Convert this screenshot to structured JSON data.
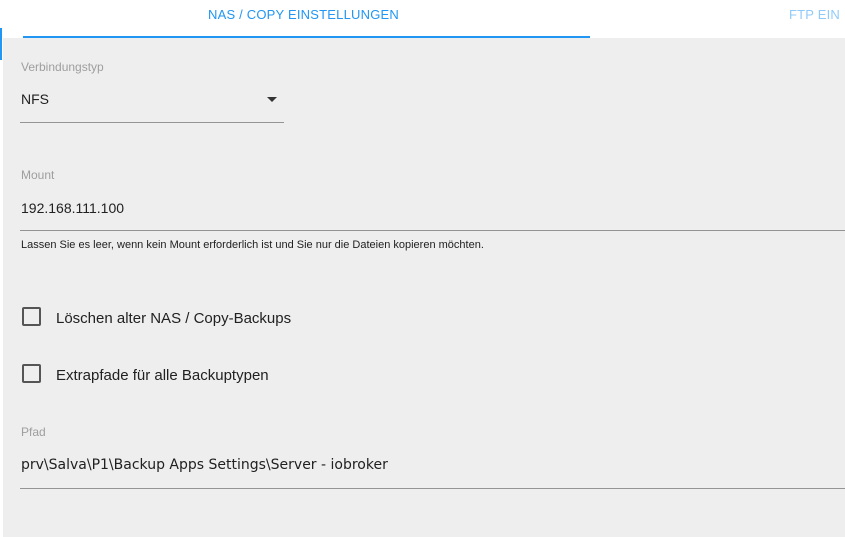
{
  "tabs": [
    {
      "label": "NAS / COPY EINSTELLUNGEN",
      "active": true
    },
    {
      "label": "FTP EIN",
      "active": false
    }
  ],
  "connection_type": {
    "label": "Verbindungstyp",
    "value": "NFS"
  },
  "mount": {
    "label": "Mount",
    "value": "192.168.111.100",
    "helper": "Lassen Sie es leer, wenn kein Mount erforderlich ist und Sie nur die Dateien kopieren möchten."
  },
  "checkboxes": [
    {
      "label": "Löschen alter NAS / Copy-Backups",
      "checked": false
    },
    {
      "label": "Extrapfade für alle Backuptypen",
      "checked": false
    }
  ],
  "path": {
    "label": "Pfad",
    "value": "prv\\Salva\\P1\\Backup Apps Settings\\Server - iobroker"
  },
  "colors": {
    "accent": "#2196f3",
    "background": "#eeeeee"
  }
}
